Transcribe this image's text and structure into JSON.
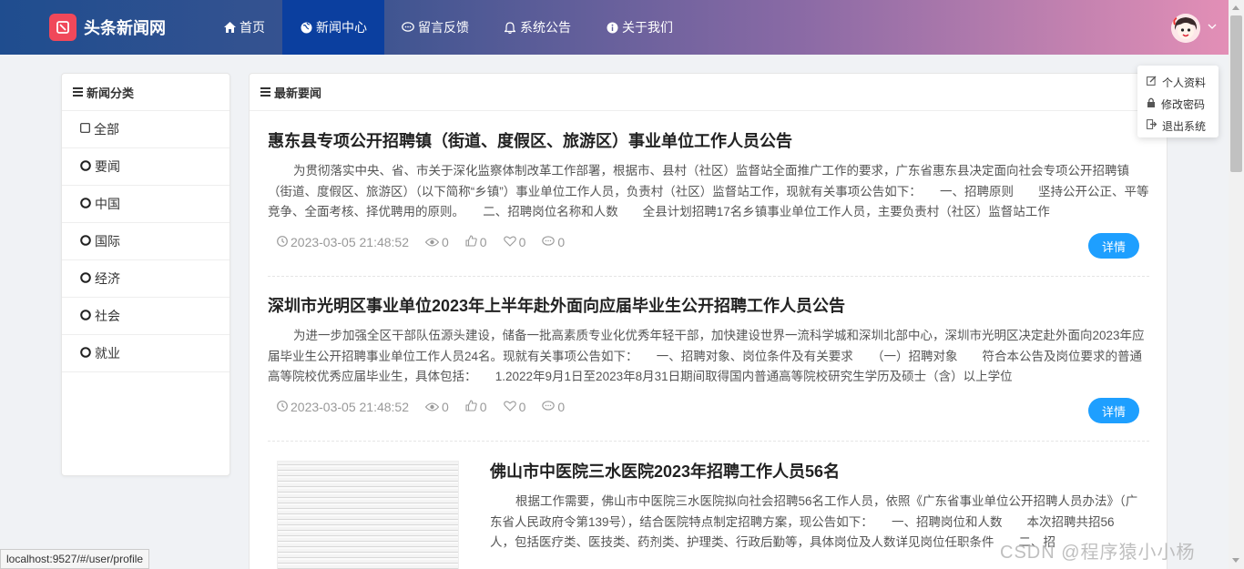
{
  "header": {
    "logo_text": "头条新闻网",
    "nav": [
      {
        "label": "首页",
        "icon": "home-icon",
        "active": false
      },
      {
        "label": "新闻中心",
        "icon": "globe-icon",
        "active": true
      },
      {
        "label": "留言反馈",
        "icon": "comment-icon",
        "active": false
      },
      {
        "label": "系统公告",
        "icon": "bell-icon",
        "active": false
      },
      {
        "label": "关于我们",
        "icon": "info-icon",
        "active": false
      }
    ]
  },
  "user_menu": {
    "items": [
      {
        "label": "个人资料",
        "icon": "edit-icon"
      },
      {
        "label": "修改密码",
        "icon": "lock-icon"
      },
      {
        "label": "退出系统",
        "icon": "logout-icon"
      }
    ]
  },
  "sidebar": {
    "title": "新闻分类",
    "items": [
      {
        "label": "全部"
      },
      {
        "label": "要闻"
      },
      {
        "label": "中国"
      },
      {
        "label": "国际"
      },
      {
        "label": "经济"
      },
      {
        "label": "社会"
      },
      {
        "label": "就业"
      }
    ]
  },
  "main": {
    "title": "最新要闻",
    "detail_label": "详情",
    "articles": [
      {
        "title": "惠东县专项公开招聘镇（街道、度假区、旅游区）事业单位工作人员公告",
        "body": "为贯彻落实中央、省、市关于深化监察体制改革工作部署，根据市、县村（社区）监督站全面推广工作的要求，广东省惠东县决定面向社会专项公开招聘镇（街道、度假区、旅游区）（以下简称“乡镇”）事业单位工作人员，负责村（社区）监督站工作，现就有关事项公告如下：　　一、招聘原则　　坚持公开公正、平等竞争、全面考核、择优聘用的原则。　　二、招聘岗位名称和人数　　全县计划招聘17名乡镇事业单位工作人员，主要负责村（社区）监督站工作",
        "date": "2023-03-05 21:48:52",
        "views": "0",
        "likes": "0",
        "favorites": "0",
        "comments": "0"
      },
      {
        "title": "深圳市光明区事业单位2023年上半年赴外面向应届毕业生公开招聘工作人员公告",
        "body": "为进一步加强全区干部队伍源头建设，储备一批高素质专业化优秀年轻干部，加快建设世界一流科学城和深圳北部中心，深圳市光明区决定赴外面向2023年应届毕业生公开招聘事业单位工作人员24名。现就有关事项公告如下：　　一、招聘对象、岗位条件及有关要求　　（一）招聘对象　　符合本公告及岗位要求的普通高等院校优秀应届毕业生，具体包括：　　1.2022年9月1日至2023年8月31日期间取得国内普通高等院校研究生学历及硕士（含）以上学位",
        "date": "2023-03-05 21:48:52",
        "views": "0",
        "likes": "0",
        "favorites": "0",
        "comments": "0"
      },
      {
        "title": "佛山市中医院三水医院2023年招聘工作人员56名",
        "body": "根据工作需要，佛山市中医院三水医院拟向社会招聘56名工作人员，依照《广东省事业单位公开招聘人员办法》（广东省人民政府令第139号），结合医院特点制定招聘方案，现公告如下：　　一、招聘岗位和人数　　本次招聘共招56人，包括医疗类、医技类、药剂类、护理类、行政后勤等，具体岗位及人数详见岗位任职条件　　二、招",
        "date": "2023-03-05 21:48:52",
        "views": "0",
        "likes": "0",
        "favorites": "0",
        "comments": "0"
      }
    ]
  },
  "statusbar": {
    "url": "localhost:9527/#/user/profile"
  },
  "watermark": "CSDN @程序猿小小杨",
  "colors": {
    "accent": "#1e9fff",
    "nav_active": "#0b3f9f",
    "logo": "#f0485a"
  }
}
